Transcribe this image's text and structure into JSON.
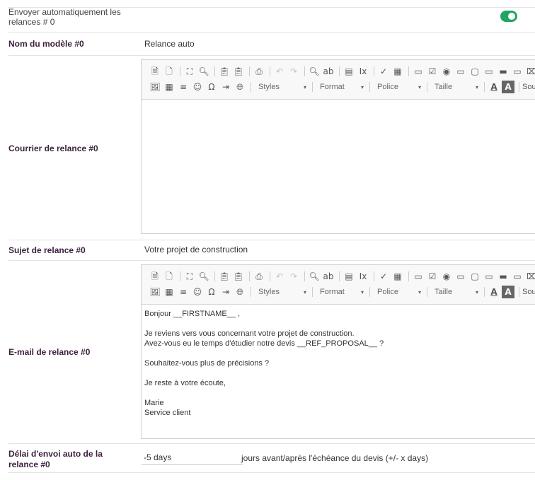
{
  "auto_send": {
    "label": "Envoyer automatiquement les relances # 0",
    "enabled": true,
    "toggle_color": "#20a566"
  },
  "template_name": {
    "label": "Nom du modèle #0",
    "value": "Relance auto"
  },
  "letter": {
    "label": "Courrier de relance #0",
    "content": []
  },
  "subject": {
    "label": "Sujet de relance #0",
    "value": "Votre projet de construction"
  },
  "email": {
    "label": "E-mail de relance #0",
    "content": [
      "Bonjour __FIRSTNAME__ ,",
      "",
      "Je reviens vers vous concernant votre projet de construction.",
      "Avez-vous eu le temps d'étudier notre devis __REF_PROPOSAL__ ?",
      "",
      "Souhaitez-vous plus de précisions ?",
      "",
      "Je reste à votre écoute,",
      "",
      "Marie",
      "Service client"
    ]
  },
  "delay": {
    "label": "Délai d'envoi auto de la relance #0",
    "value": "-5 days",
    "suffix": "jours avant/après l'échéance du devis (+/- x days)"
  },
  "toolbar": {
    "row1": [
      {
        "name": "source-icon",
        "glyph": "🗎"
      },
      {
        "name": "new-page-icon",
        "glyph": "🗋"
      },
      {
        "sep": true
      },
      {
        "name": "maximize-icon",
        "glyph": "⛶"
      },
      {
        "name": "preview-icon",
        "glyph": "🔍︎"
      },
      {
        "sep": true
      },
      {
        "name": "paste-text-icon",
        "glyph": "📋︎"
      },
      {
        "name": "paste-word-icon",
        "glyph": "📋︎"
      },
      {
        "sep": true
      },
      {
        "name": "print-icon",
        "glyph": "⎙"
      },
      {
        "sep": true
      },
      {
        "name": "undo-icon",
        "glyph": "↶",
        "disabled": true
      },
      {
        "name": "redo-icon",
        "glyph": "↷",
        "disabled": true
      },
      {
        "sep": true
      },
      {
        "name": "find-icon",
        "glyph": "🔍︎"
      },
      {
        "name": "replace-icon",
        "glyph": "ab"
      },
      {
        "sep": true
      },
      {
        "name": "select-all-icon",
        "glyph": "▤"
      },
      {
        "name": "remove-format-icon",
        "glyph": "Ix"
      },
      {
        "sep": true
      },
      {
        "name": "spellcheck-icon",
        "glyph": "✓"
      },
      {
        "name": "form-icon",
        "glyph": "▦"
      },
      {
        "sep": true
      },
      {
        "name": "textfield-icon",
        "glyph": "▭"
      },
      {
        "name": "checkbox-icon",
        "glyph": "☑"
      },
      {
        "name": "radio-icon",
        "glyph": "◉"
      },
      {
        "name": "textarea-icon",
        "glyph": "▭"
      },
      {
        "name": "select-icon",
        "glyph": "▢"
      },
      {
        "name": "dropdown-icon",
        "glyph": "▭"
      },
      {
        "name": "button-icon",
        "glyph": "▬"
      },
      {
        "name": "image-button-icon",
        "glyph": "▭"
      },
      {
        "name": "hidden-field-icon",
        "glyph": "⌧"
      }
    ],
    "row2": {
      "icons": [
        {
          "name": "image-icon",
          "glyph": "🖼︎"
        },
        {
          "name": "table-icon",
          "glyph": "▦"
        },
        {
          "name": "horizontal-line-icon",
          "glyph": "≡"
        },
        {
          "name": "smiley-icon",
          "glyph": "☺"
        },
        {
          "name": "special-char-icon",
          "glyph": "Ω"
        },
        {
          "name": "page-break-icon",
          "glyph": "⇥"
        },
        {
          "name": "iframe-icon",
          "glyph": "🌐︎"
        }
      ],
      "styles": "Styles",
      "format": "Format",
      "font": "Police",
      "size": "Taille",
      "text_color_icon": "A",
      "bg_color_icon": "A",
      "source_label": "Sou"
    }
  }
}
